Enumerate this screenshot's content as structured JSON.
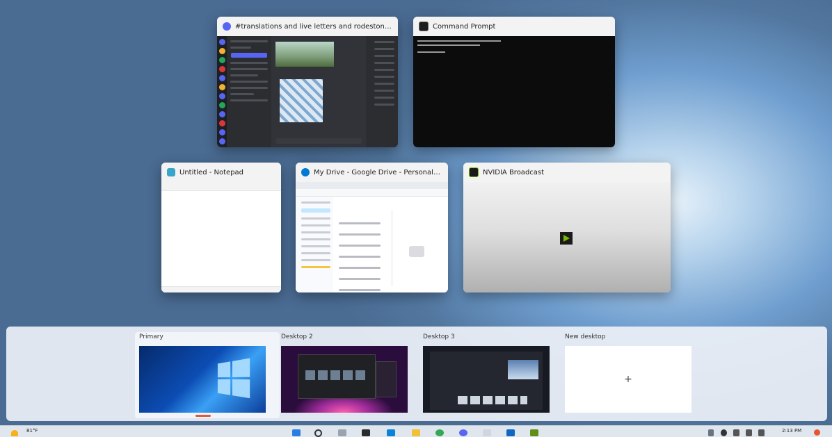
{
  "windows": [
    {
      "title": "#translations and live letters and rodestone feed |...",
      "app": "Discord"
    },
    {
      "title": "Command Prompt",
      "app": "Command Prompt"
    },
    {
      "title": "Untitled - Notepad",
      "app": "Notepad"
    },
    {
      "title": "My Drive - Google Drive - Personal - Micr...",
      "app": "Microsoft Edge"
    },
    {
      "title": "NVIDIA Broadcast",
      "app": "NVIDIA Broadcast"
    }
  ],
  "desktops": [
    {
      "label": "Primary",
      "selected": true
    },
    {
      "label": "Desktop 2",
      "selected": false
    },
    {
      "label": "Desktop 3",
      "selected": false
    },
    {
      "label": "New desktop",
      "symbol": "+"
    }
  ],
  "taskbar": {
    "weather": "81°F",
    "time": "2:13 PM",
    "icons": [
      "start-icon",
      "search-icon",
      "task-view-icon",
      "terminal-icon",
      "edge-icon",
      "file-explorer-icon",
      "chrome-icon",
      "discord-icon",
      "store-icon",
      "outlook-icon",
      "nvidia-icon"
    ]
  },
  "colors": {
    "discord": "#5865f2",
    "nvidia": "#76b900",
    "edge": "#0078d4",
    "accent_underline": "#e05b3a"
  }
}
